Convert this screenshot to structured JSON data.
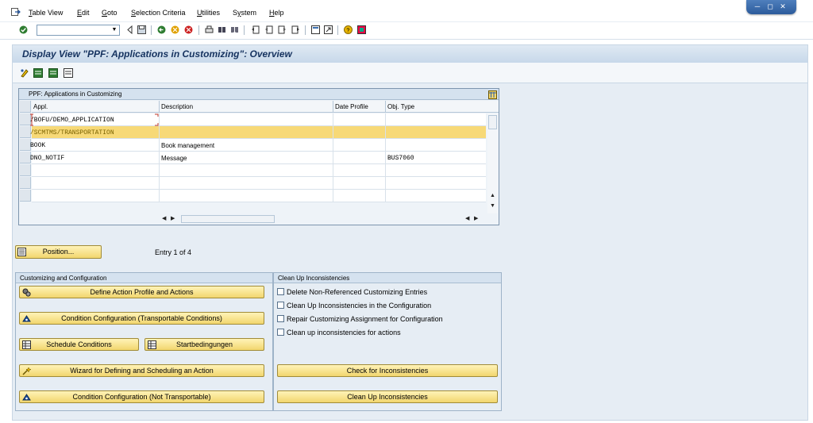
{
  "menu": [
    "Table View",
    "Edit",
    "Goto",
    "Selection Criteria",
    "Utilities",
    "System",
    "Help"
  ],
  "menu_mnemonics": [
    "T",
    "E",
    "G",
    "S",
    "U",
    "y",
    "H"
  ],
  "window_controls": [
    "minimize-icon",
    "restore-icon",
    "close-icon"
  ],
  "command_field": {
    "value": "",
    "placeholder": ""
  },
  "page_title": "Display View \"PPF: Applications in Customizing\": Overview",
  "table": {
    "title": "PPF: Applications in Customizing",
    "columns": [
      "Appl.",
      "Description",
      "Date Profile",
      "Obj. Type"
    ],
    "rows": [
      {
        "appl": "/BOFU/DEMO_APPLICATION",
        "description": "",
        "date_profile": "",
        "obj_type": ""
      },
      {
        "appl": "/SCMTMS/TRANSPORTATION",
        "description": "",
        "date_profile": "",
        "obj_type": ""
      },
      {
        "appl": "BOOK",
        "description": "Book management",
        "date_profile": "",
        "obj_type": ""
      },
      {
        "appl": "DNO_NOTIF",
        "description": "Message",
        "date_profile": "",
        "obj_type": "BUS7060"
      }
    ],
    "selected_row": 1
  },
  "position_button": "Position...",
  "entry_text": "Entry 1 of 4",
  "customizing_group": {
    "title": "Customizing and Configuration",
    "buttons": {
      "define": "Define Action Profile and Actions",
      "cond_transport": "Condition Configuration (Transportable Conditions)",
      "schedule": "Schedule Conditions",
      "start": "Startbedingungen",
      "wizard": "Wizard for Defining and Scheduling an Action",
      "cond_not_transport": "Condition Configuration (Not Transportable)"
    }
  },
  "cleanup_group": {
    "title": "Clean Up Inconsistencies",
    "checkboxes": [
      "Delete Non-Referenced Customizing Entries",
      "Clean Up Inconsistencies in the Configuration",
      "Repair Customizing Assignment for Configuration",
      "Clean up inconsistencies for actions"
    ],
    "check_button": "Check for Inconsistencies",
    "cleanup_button": "Clean Up Inconsistencies"
  },
  "colors": {
    "button_yellow": "#f2d66e",
    "selected_row": "#f7d977",
    "title_blue": "#15325f"
  }
}
